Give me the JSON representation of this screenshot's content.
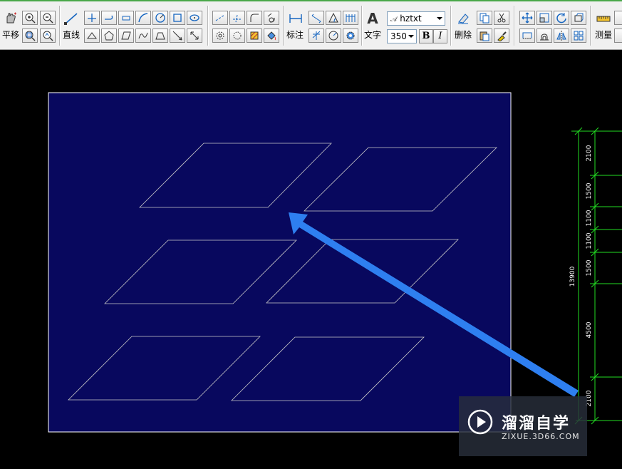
{
  "toolbar": {
    "pan_label": "平移",
    "line_label": "直线",
    "dimension_label": "标注",
    "text_label": "文字",
    "font_name": "hztxt",
    "font_size": "350",
    "bold_label": "B",
    "italic_label": "I",
    "delete_label": "删除",
    "measure_label": "测量"
  },
  "drawing": {
    "dimensions": {
      "total": "13900",
      "segments": [
        "2100",
        "1500",
        "1100",
        "1100",
        "1500",
        "4500",
        "2100"
      ]
    }
  },
  "watermark": {
    "title": "溜溜自学",
    "url": "ZIXUE.3D66.COM"
  },
  "colors": {
    "toolbar_bg": "#f0f0f0",
    "canvas_bg": "#000000",
    "sheet_bg": "#08085e",
    "outline": "#c8c8c8",
    "dimension_line": "#22dd22",
    "arrow": "#2e7ff0"
  }
}
